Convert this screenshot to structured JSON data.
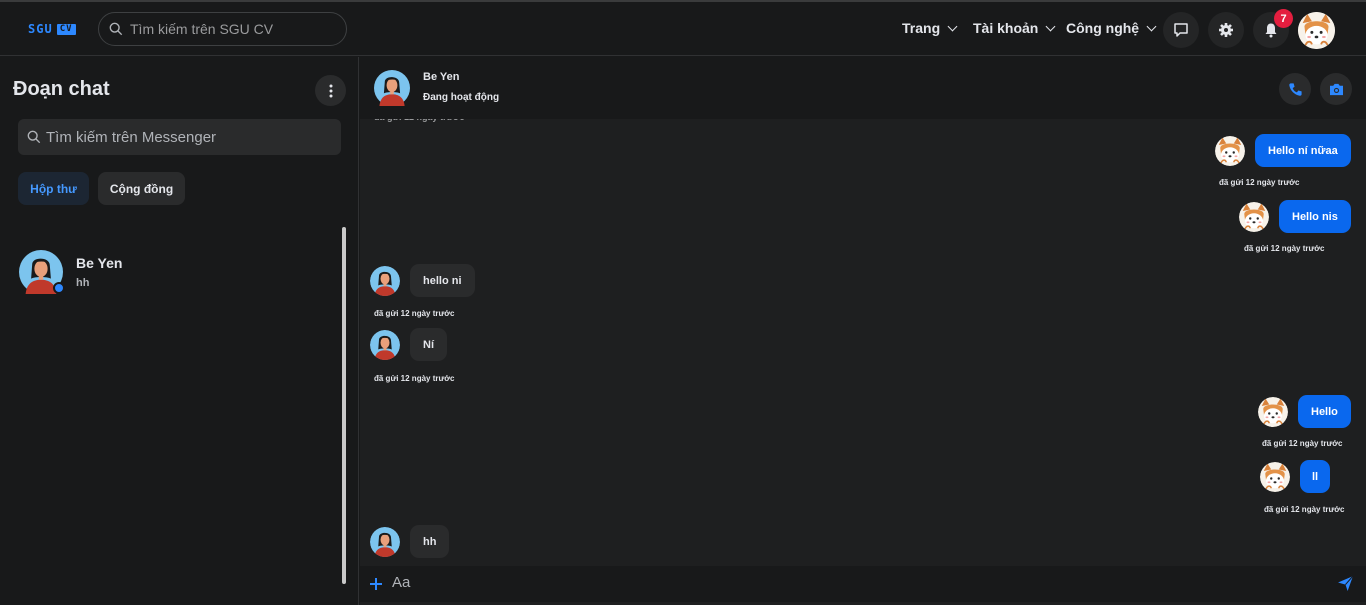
{
  "navbar": {
    "logo_text": "SGU",
    "logo_badge": "CV",
    "search_placeholder": "Tìm kiếm trên SGU CV",
    "menus": [
      {
        "label": "Trang"
      },
      {
        "label": "Tài khoản"
      },
      {
        "label": "Công nghệ"
      }
    ],
    "notification_count": "7"
  },
  "sidebar": {
    "title": "Đoạn chat",
    "search_placeholder": "Tìm kiếm trên Messenger",
    "tabs": [
      {
        "label": "Hộp thư"
      },
      {
        "label": "Cộng đồng"
      }
    ],
    "conversations": [
      {
        "name": "Be Yen",
        "last_message": "hh"
      }
    ]
  },
  "chat": {
    "contact_name": "Be Yen",
    "contact_status": "Đang hoạt động",
    "messages": [
      {
        "direction": "out",
        "text": "Hello ní nữaa",
        "time": "đã gửi 12 ngày trước"
      },
      {
        "direction": "out",
        "text": "Hello nis",
        "time": "đã gửi 12 ngày trước"
      },
      {
        "direction": "in",
        "text": "hello ni",
        "time": "đã gửi 12 ngày trước"
      },
      {
        "direction": "in",
        "text": "Ní",
        "time": "đã gửi 12 ngày trước"
      },
      {
        "direction": "out",
        "text": "Hello",
        "time": "đã gửi 12 ngày trước"
      },
      {
        "direction": "out",
        "text": "ll",
        "time": "đã gửi 12 ngày trước"
      },
      {
        "direction": "in",
        "text": "hh",
        "time": ""
      }
    ],
    "composer_placeholder": "Aa"
  },
  "colors": {
    "accent": "#0a68ee",
    "link": "#2d88ff",
    "badge": "#e41e3f",
    "background": "#18191a"
  },
  "icons": [
    "search-icon",
    "chevron-down-icon",
    "message-icon",
    "gear-icon",
    "bell-icon",
    "more-vertical-icon",
    "phone-icon",
    "camera-icon",
    "plus-icon",
    "send-icon"
  ]
}
